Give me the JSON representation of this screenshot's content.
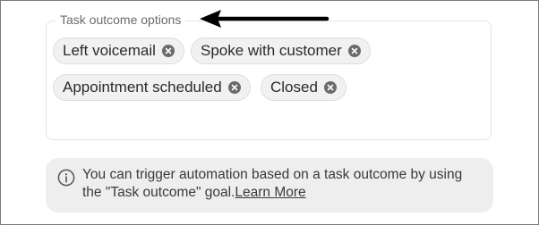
{
  "fieldset": {
    "legend": "Task outcome options",
    "chips": [
      {
        "label": "Left voicemail"
      },
      {
        "label": "Spoke with customer"
      },
      {
        "label": "Appointment scheduled"
      },
      {
        "label": "Closed"
      }
    ]
  },
  "info": {
    "icon": "info-circle-icon",
    "text": "You can trigger automation based on a task outcome by using the \"Task outcome\" goal.",
    "link_label": "Learn More"
  },
  "annotation": {
    "icon": "arrow-left-icon",
    "color": "#000000"
  }
}
